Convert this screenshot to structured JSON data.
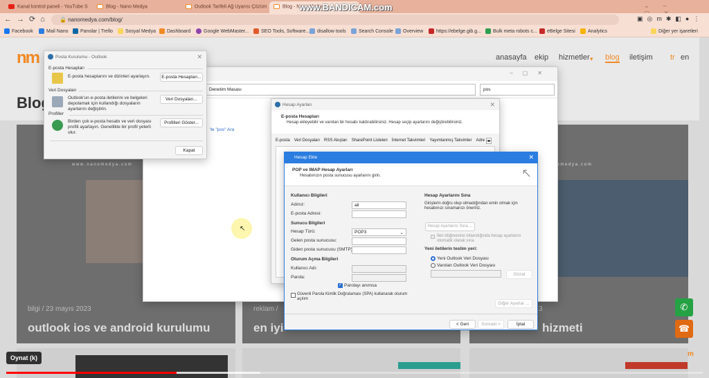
{
  "browser": {
    "tabs": [
      {
        "label": "Kanal kontrol paneli - YouTube S",
        "color": "#e62117"
      },
      {
        "label": "Blog - Nano Medya",
        "color": "#f08a24"
      },
      {
        "label": "Outlook Tarifeli Ağ Uyarısı Çözüm",
        "color": "#f08a24"
      },
      {
        "label": "Blog - Nano Medya",
        "color": "#f08a24"
      }
    ],
    "url": "nanomedya.com/blog/",
    "bookmarks": [
      "Facebook",
      "Mail Nano",
      "Panolar | Trello",
      "Sosyal Medya",
      "Dashboard",
      "Google WebMaster...",
      "SEO Tools, Software...",
      "disallow tools",
      "Search Console",
      "Overview",
      "https://ebelge.gib.g...",
      "Bulk meta robots c...",
      "eBelge Sitesi",
      "Analytics"
    ],
    "other_bookmarks": "Diğer yer işaretleri",
    "watermark": "www.BANDICAM.com"
  },
  "site": {
    "logo": "nm",
    "nav": [
      "anasayfa",
      "ekip",
      "hizmetler",
      "blog",
      "iletişim"
    ],
    "lang": [
      "tr",
      "en"
    ],
    "page_title": "Blog",
    "domain_caption": "w w w . n a n o m e d y a . c o m",
    "cards": [
      {
        "meta": "bilgi / 23 mayıs 2023",
        "title": "outlook ios ve android kurulumu"
      },
      {
        "meta": "reklam /",
        "title": "en iyi"
      },
      {
        "meta": "3",
        "title": "hizmeti"
      }
    ],
    "accent": "#f08a24"
  },
  "control_panel": {
    "address": "Denetim Masası",
    "search": "pos",
    "search_link": "'te \"pos\" Ara"
  },
  "posta": {
    "title": "Posta Kurulumu - Outlook",
    "sections": [
      {
        "heading": "E-posta Hesapları",
        "text": "E-posta hesaplarını ve dizinleri ayarlayın.",
        "button": "E-posta Hesapları..."
      },
      {
        "heading": "Veri Dosyaları",
        "text": "Outlook'un e-posta iletilerini ve belgeleri depolamak için kullandığı dosyaların ayarlarını değiştirin.",
        "button": "Veri Dosyaları..."
      },
      {
        "heading": "Profiller",
        "text": "Birden çok e-posta hesabı ve veri dosyası profili ayarlayın. Genellikle bir profil yeterli olur.",
        "button": "Profilleri Göster..."
      }
    ],
    "close": "Kapat"
  },
  "hesap_ayarlari": {
    "title": "Hesap Ayarları",
    "heading": "E-posta Hesapları",
    "desc": "Hesap ekleyebilir ve varolan bir hesabı kaldırabilirsiniz. Hesap seçip ayarlarını değiştirebilirsiniz.",
    "tabs": [
      "E-posta",
      "Veri Dosyaları",
      "RSS Akışları",
      "SharePoint Listeleri",
      "İnternet Takvimleri",
      "Yayımlanmış Takvimler",
      "Adre"
    ]
  },
  "hesap_ekle": {
    "title": "Hesap Ekle",
    "heading": "POP ve IMAP Hesap Ayarları",
    "subheading": "Hesabınızın posta sunucusu ayarlarını girin.",
    "user_info": "Kullanıcı Bilgileri",
    "name_label": "Adınız:",
    "name_value": "ali",
    "email_label": "E-posta Adresi:",
    "email_value": "",
    "server_info": "Sunucu Bilgileri",
    "type_label": "Hesap Türü:",
    "type_value": "POP3",
    "incoming_label": "Gelen posta sunucusu:",
    "outgoing_label": "Giden posta sunucusu (SMTP):",
    "logon_info": "Oturum Açma Bilgileri",
    "user_label": "Kullanıcı Adı:",
    "password_label": "Parola:",
    "remember": "Parolayı anımsa",
    "remember_checked": true,
    "spa": "Güvenli Parola Kimlik Doğrulaması (SPA) kullanarak oturum açılım",
    "spa_checked": false,
    "test_heading": "Hesap Ayarlarını Sına",
    "test_desc": "Girişlerin doğru olup olmadığından emin olmak için hesabınızı sınamanızı öneririz.",
    "test_button": "Hesap Ayarlarını Sına ...",
    "auto_test": "İleri düğmesine tıklandığında hesap ayarlarını otomatik olarak sına",
    "deliver_heading": "Yeni iletilerin teslim yeri:",
    "radio_new": "Yeni Outlook Veri Dosyası",
    "radio_existing": "Varolan Outlook Veri Dosyası",
    "browse": "Gözat",
    "more": "Diğer Ayarlar ...",
    "back": "< Geri",
    "next": "Sonraki >",
    "cancel": "İptal"
  },
  "video": {
    "tooltip": "Oynat (k)",
    "progress": 0.245,
    "buffered": 0.365
  }
}
